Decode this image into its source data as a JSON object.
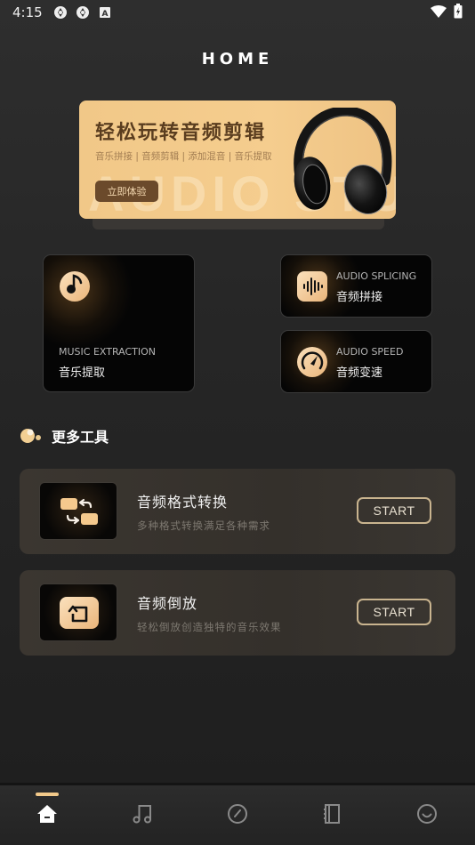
{
  "status_bar": {
    "time": "4:15",
    "left_icons": [
      "shutter-icon",
      "shutter-icon",
      "keyboard-a-icon"
    ],
    "right_icons": [
      "wifi-icon",
      "battery-charging-icon"
    ]
  },
  "header": {
    "title": "HOME"
  },
  "banner": {
    "title": "轻松玩转音频剪辑",
    "subtitle": "音乐拼接 | 音频剪辑 | 添加混音 | 音乐提取",
    "watermark": "AUDIO STUDIO",
    "cta_label": "立即体验",
    "image": "headphones-icon"
  },
  "feature_cards": [
    {
      "id": "music-extraction",
      "en": "MUSIC EXTRACTION",
      "zh": "音乐提取",
      "icon": "music-disc-icon"
    },
    {
      "id": "audio-splicing",
      "en": "AUDIO SPLICING",
      "zh": "音频拼接",
      "icon": "waveform-icon"
    },
    {
      "id": "audio-speed",
      "en": "AUDIO SPEED",
      "zh": "音频变速",
      "icon": "speedometer-icon"
    }
  ],
  "more_tools": {
    "title": "更多工具",
    "items": [
      {
        "title": "音频格式转换",
        "desc": "多种格式转换满足各种需求",
        "button": "START",
        "icon": "format-convert-icon"
      },
      {
        "title": "音频倒放",
        "desc": "轻松倒放创造独特的音乐效果",
        "button": "START",
        "icon": "reverse-icon"
      }
    ]
  },
  "bottom_nav": {
    "items": [
      {
        "id": "home",
        "icon": "home-icon",
        "active": true
      },
      {
        "id": "music",
        "icon": "music-note-icon",
        "active": false
      },
      {
        "id": "speed",
        "icon": "gauge-icon",
        "active": false
      },
      {
        "id": "notebook",
        "icon": "notebook-icon",
        "active": false
      },
      {
        "id": "profile",
        "icon": "smiley-icon",
        "active": false
      }
    ]
  },
  "colors": {
    "accent": "#f2c98a",
    "banner_bg": "#f5cd8e",
    "banner_title": "#5a3d1f",
    "banner_button": "#6b4a2b",
    "start_border": "#c9b48f"
  }
}
